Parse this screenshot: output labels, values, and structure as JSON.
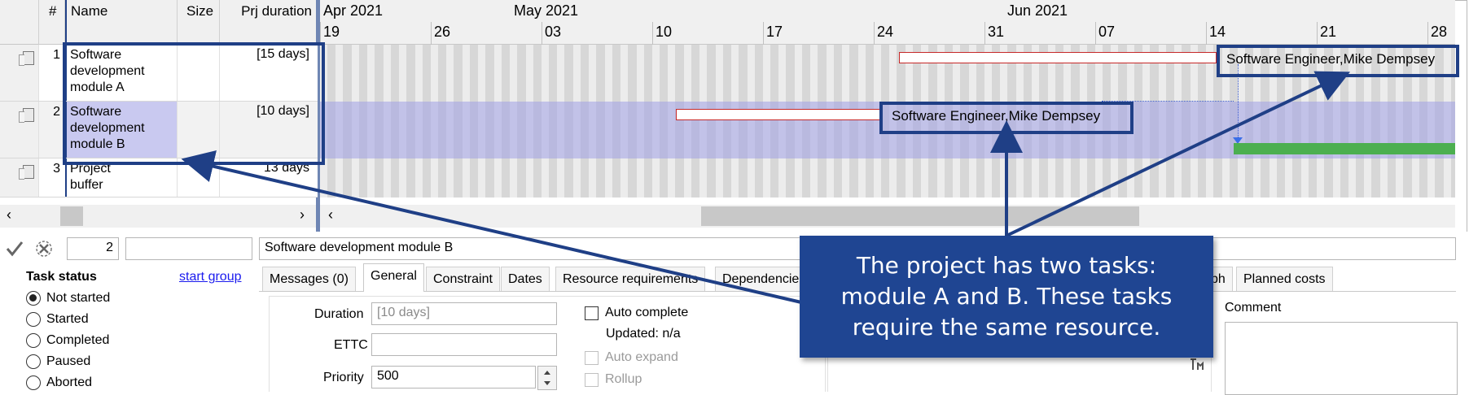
{
  "grid": {
    "headers": {
      "num": "#",
      "name": "Name",
      "size": "Size",
      "duration": "Prj duration"
    },
    "rows": [
      {
        "num": "1",
        "name": "Software development module A",
        "size": "",
        "duration": "[15 days]"
      },
      {
        "num": "2",
        "name": "Software development module B",
        "size": "",
        "duration": "[10 days]"
      },
      {
        "num": "3",
        "name": "Project buffer",
        "size": "",
        "duration": "13 days"
      }
    ],
    "scroll_left": "‹",
    "scroll_right": "›"
  },
  "timeline": {
    "months": [
      "Apr 2021",
      "May 2021",
      "Jun 2021"
    ],
    "days": [
      "19",
      "26",
      "03",
      "10",
      "17",
      "24",
      "31",
      "07",
      "14",
      "21",
      "28"
    ],
    "scroll_left": "‹"
  },
  "gantt": {
    "bar_labels": [
      "Software Engineer,Mike Dempsey",
      "Software Engineer,Mike Dempsey"
    ]
  },
  "editor": {
    "task_number": "2",
    "task_code": "",
    "task_name": "Software development module B",
    "status_title": "Task status",
    "start_group": "start group",
    "statuses": [
      "Not started",
      "Started",
      "Completed",
      "Paused",
      "Aborted"
    ],
    "selected_status": "Not started",
    "tabs": [
      "Messages (0)",
      "General",
      "Constraint",
      "Dates",
      "Resource requirements",
      "Dependencie",
      "ph",
      "Planned costs"
    ],
    "active_tab": "General",
    "duration_label": "Duration",
    "duration_value": "[10 days]",
    "ettc_label": "ETTC",
    "ettc_value": "",
    "priority_label": "Priority",
    "priority_value": "500",
    "auto_complete": "Auto complete",
    "updated": "Updated: n/a",
    "auto_expand": "Auto expand",
    "rollup": "Rollup",
    "comment_label": "Comment",
    "comment_value": ""
  },
  "callout": {
    "text": "The project has two tasks: module A and B. These tasks require the same resource."
  },
  "colors": {
    "callout_bg": "#1f4592",
    "callout_border": "#1f3f86",
    "selected_row": "#c9c9f0",
    "critical_bar_border": "#c62828",
    "buffer_bar": "#4caf50"
  }
}
